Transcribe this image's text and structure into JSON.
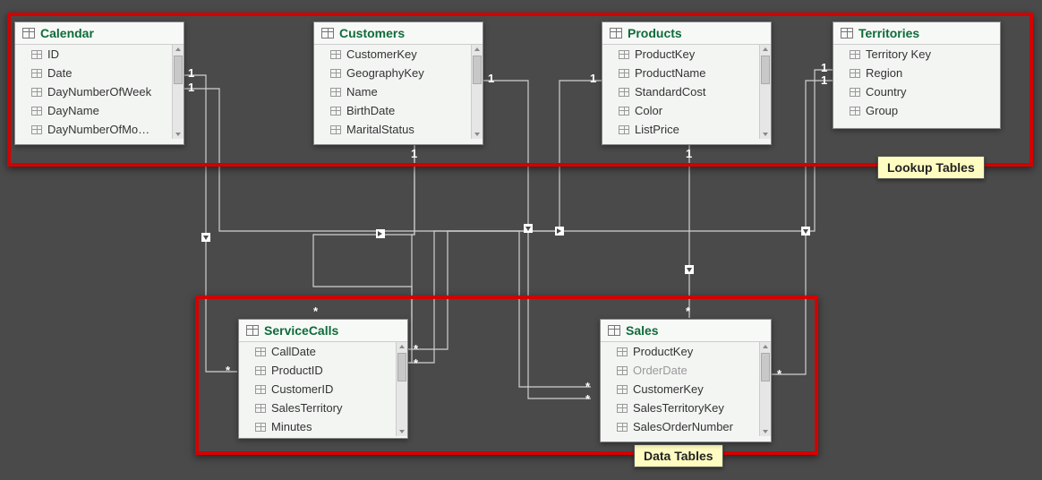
{
  "groups": {
    "lookup": {
      "label": "Lookup Tables"
    },
    "data": {
      "label": "Data Tables"
    }
  },
  "tables": {
    "calendar": {
      "title": "Calendar",
      "fields": [
        "ID",
        "Date",
        "DayNumberOfWeek",
        "DayName",
        "DayNumberOfMo…"
      ],
      "scroll": true
    },
    "customers": {
      "title": "Customers",
      "fields": [
        "CustomerKey",
        "GeographyKey",
        "Name",
        "BirthDate",
        "MaritalStatus"
      ],
      "scroll": true
    },
    "products": {
      "title": "Products",
      "fields": [
        "ProductKey",
        "ProductName",
        "StandardCost",
        "Color",
        "ListPrice"
      ],
      "scroll": true
    },
    "territories": {
      "title": "Territories",
      "fields": [
        "Territory Key",
        "Region",
        "Country",
        "Group"
      ],
      "scroll": false
    },
    "servicecalls": {
      "title": "ServiceCalls",
      "fields": [
        "CallDate",
        "ProductID",
        "CustomerID",
        "SalesTerritory",
        "Minutes"
      ],
      "scroll": true
    },
    "sales": {
      "title": "Sales",
      "fields": [
        "ProductKey",
        "OrderDate",
        "CustomerKey",
        "SalesTerritoryKey",
        "SalesOrderNumber"
      ],
      "mutedFields": [
        "OrderDate"
      ],
      "scroll": true
    }
  },
  "cardinality": {
    "calendar_out1": "1",
    "calendar_out2": "1",
    "customers_out1": "1",
    "customers_out2": "1",
    "products_out1": "1",
    "products_out2": "1",
    "territories_out1": "1",
    "territories_out2": "1",
    "sc_in1": "*",
    "sc_in2": "*",
    "sc_in3": "*",
    "sc_in_left": "*",
    "sales_in1": "*",
    "sales_in2": "*",
    "sales_in3": "*",
    "sales_in_right": "*"
  }
}
